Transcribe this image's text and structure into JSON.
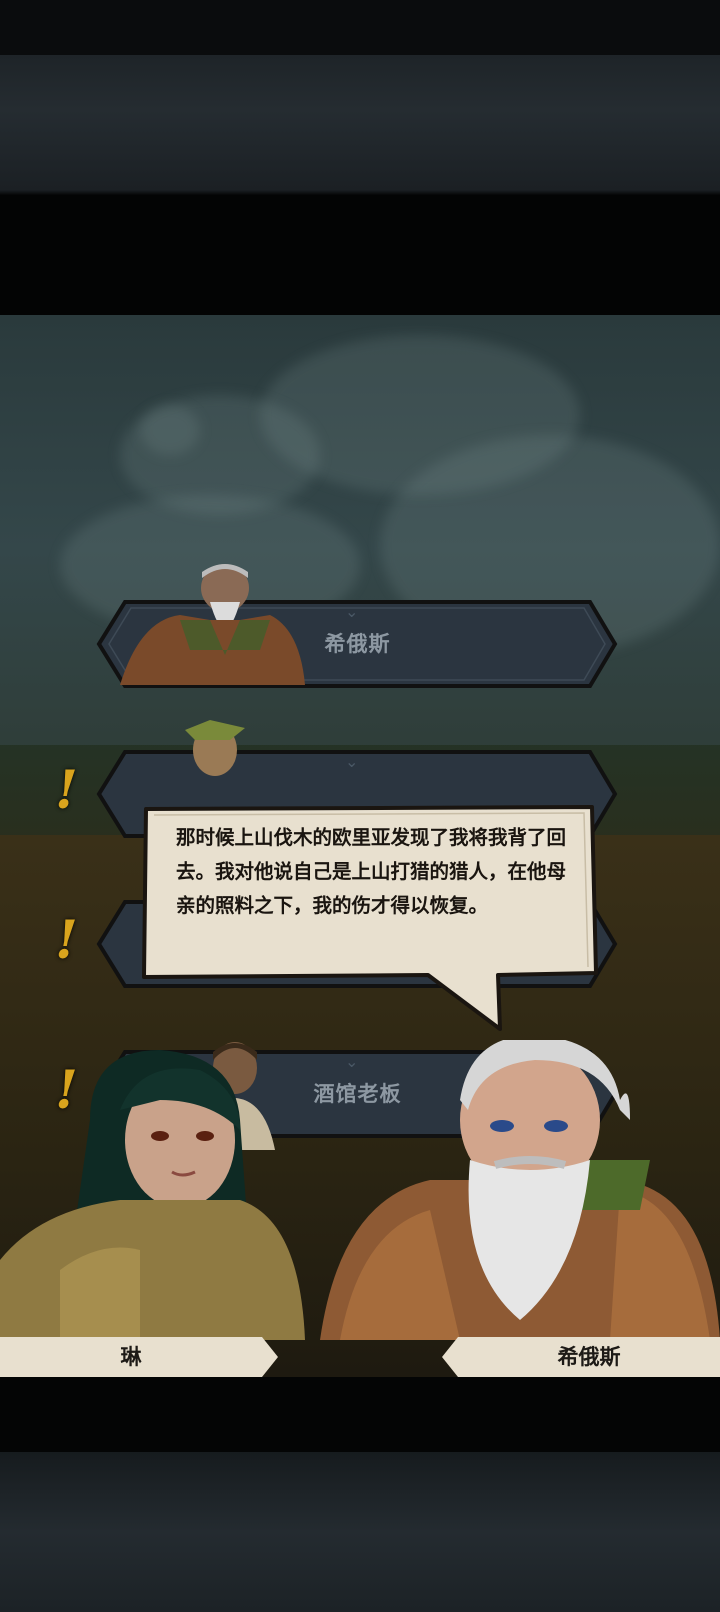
{
  "npc_list": [
    {
      "name": "希俄斯"
    },
    {
      "name": ""
    },
    {
      "name": ""
    },
    {
      "name": "酒馆老板"
    }
  ],
  "alerts": [
    "!",
    "!",
    "!"
  ],
  "dialog": {
    "text": "那时候上山伐木的欧里亚发现了我将我背了回去。我对他说自己是上山打猎的猎人，在他母亲的照料之下，我的伤才得以恢复。"
  },
  "speakers": {
    "left": {
      "name": "琳"
    },
    "right": {
      "name": "希俄斯"
    }
  },
  "colors": {
    "plate_fill": "#2b3540",
    "parchment": "#e8e0cf",
    "alert": "#d9a41d"
  }
}
